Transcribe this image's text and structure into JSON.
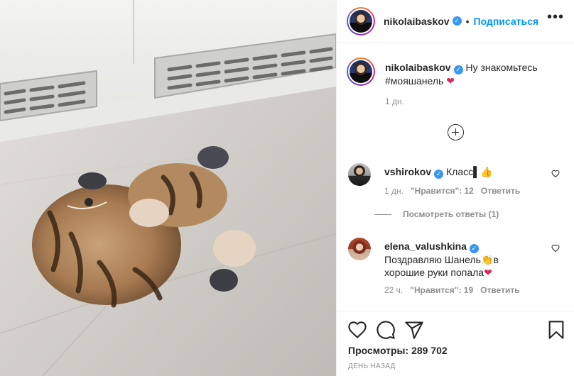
{
  "post": {
    "author": "nikolaibaskov",
    "follow_label": "Подписаться",
    "separator": "•",
    "more_label": "•••",
    "caption_text": "Ну знакомьтесь #мояшанель",
    "caption_heart": "❤",
    "caption_time": "1 дн."
  },
  "comments": [
    {
      "username": "vshirokov",
      "text": "Класс",
      "emoji": "▌👍",
      "time": "1 дн.",
      "likes": "\"Нравится\": 12",
      "reply": "Ответить",
      "view_replies": "Посмотреть ответы (1)"
    },
    {
      "username": "elena_valushkina",
      "text_before": "Поздравляю Шанель",
      "emoji": "👏",
      "text_after": "в хорошие руки попала",
      "heart": "❤",
      "time": "22 ч.",
      "likes": "\"Нравится\": 19",
      "reply": "Ответить"
    }
  ],
  "stats": {
    "views_label": "Просмотры:",
    "views_value": "289 702",
    "date": "ДЕНЬ НАЗАД"
  },
  "icons": {
    "verified": "✓",
    "like": "heart-icon",
    "comment": "comment-icon",
    "share": "share-icon",
    "save": "bookmark-icon"
  },
  "colors": {
    "accent": "#0095f6",
    "verified": "#3897f0",
    "heart": "#e0245e",
    "muted": "#8e8e8e"
  }
}
